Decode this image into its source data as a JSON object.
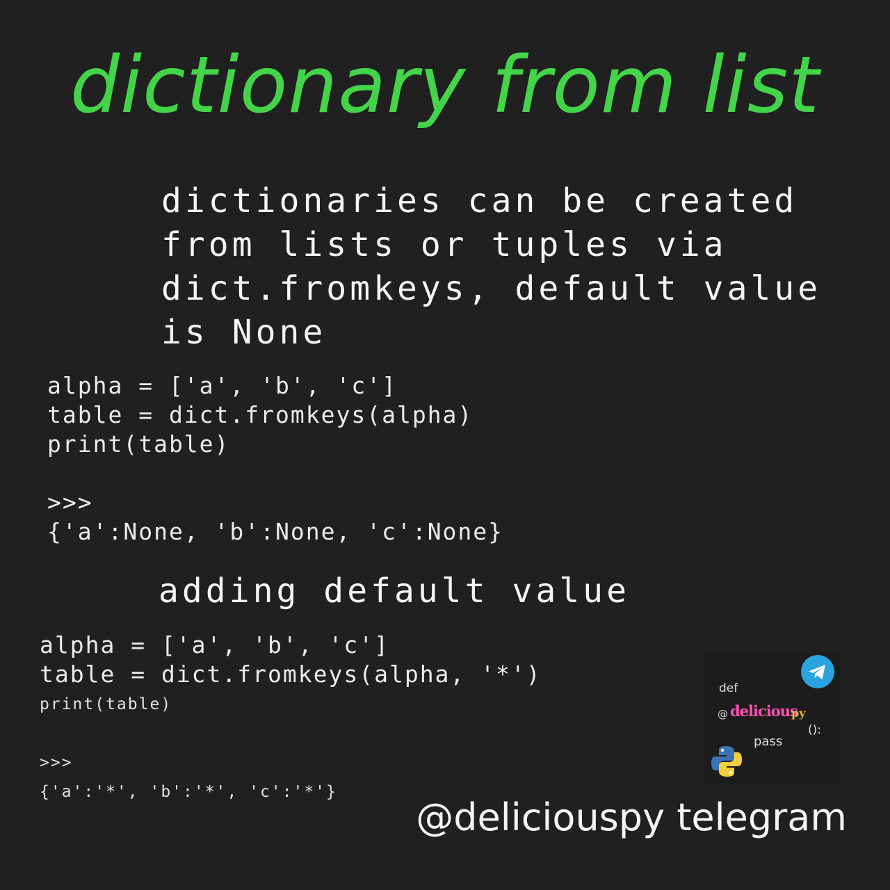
{
  "title": "dictionary from list",
  "intro_lines": [
    "dictionaries can be created",
    "from lists or tuples via",
    "dict.fromkeys, default value",
    "is None"
  ],
  "example1": {
    "code": [
      "alpha = ['a', 'b', 'c']",
      "table = dict.fromkeys(alpha)",
      "print(table)"
    ],
    "prompt": ">>>",
    "output": "{'a':None, 'b':None, 'c':None}"
  },
  "section2_heading": "adding default value",
  "example2": {
    "code": [
      "alpha = ['a', 'b', 'c']",
      "table = dict.fromkeys(alpha, '*')"
    ],
    "code_small": "print(table)",
    "prompt": ">>>",
    "output": "{'a':'*', 'b':'*', 'c':'*'}"
  },
  "logo": {
    "def": "def",
    "at": "@",
    "brand": "delicious",
    "brand_suffix": "py",
    "paren": "():",
    "pass": "pass",
    "icons": [
      "telegram-icon",
      "python-icon"
    ]
  },
  "footer": "@deliciouspy telegram",
  "colors": {
    "background": "#202020",
    "title": "#44d44a",
    "text": "#f5f5f5",
    "brand": "#ff4fb4",
    "telegram": "#2aa3df"
  }
}
